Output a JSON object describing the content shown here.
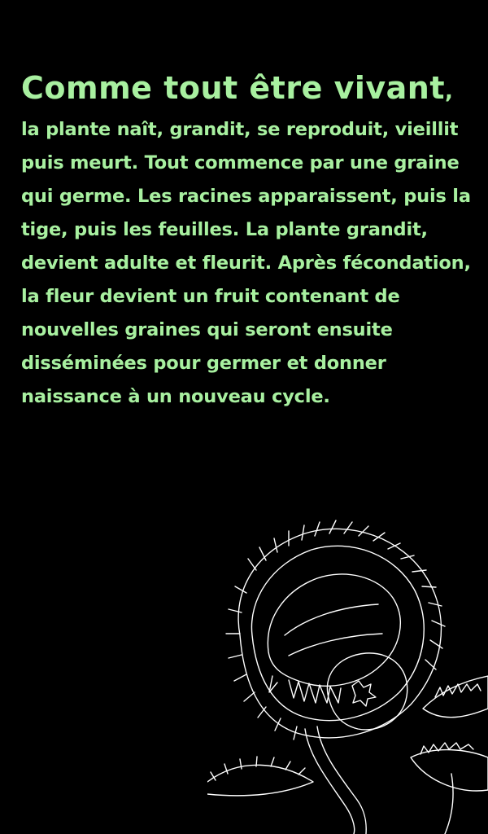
{
  "colors": {
    "background": "#000000",
    "text": "#a8f0a0",
    "lineart": "#ffffff"
  },
  "headline": {
    "text": "Comme tout être vivant",
    "comma": ","
  },
  "paragraph": {
    "lines": [
      "la plante naît, grandit, se reproduit, vieillit",
      "puis meurt. Tout commence par une graine",
      "qui germe. Les racines apparaissent, puis la",
      "tige, puis les feuilles. La plante grandit,",
      "devient adulte et fleurit. Après fécondation,",
      "la fleur devient un fruit contenant de",
      "nouvelles graines qui seront ensuite",
      "disséminées pour germer et donner",
      "naissance à un nouveau cycle."
    ]
  },
  "illustration": {
    "subject": "carnivorous-plant-lineart"
  }
}
